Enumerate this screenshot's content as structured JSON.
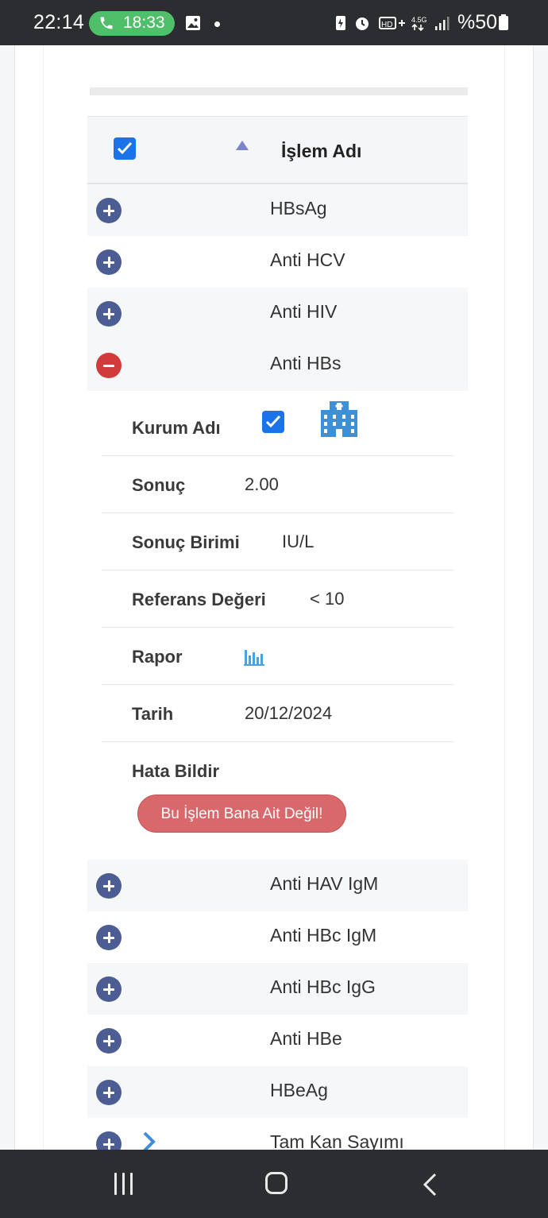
{
  "status_bar": {
    "time": "22:14",
    "call_timer": "18:33",
    "network": "4.5G",
    "battery": "%50"
  },
  "table": {
    "header": {
      "column_title": "İşlem Adı",
      "select_all_checked": true,
      "sort": "ascending"
    },
    "rows_before": [
      {
        "name": "HBsAg",
        "expanded": false
      },
      {
        "name": "Anti HCV",
        "expanded": false
      },
      {
        "name": "Anti HIV",
        "expanded": false
      }
    ],
    "expanded_row": {
      "name": "Anti HBs",
      "expanded": true,
      "details": {
        "kurum_adi_label": "Kurum Adı",
        "kurum_adi_checked": true,
        "sonuc_label": "Sonuç",
        "sonuc_value": "2.00",
        "sonuc_birimi_label": "Sonuç Birimi",
        "sonuc_birimi_value": "IU/L",
        "referans_label": "Referans Değeri",
        "referans_value": "< 10",
        "rapor_label": "Rapor",
        "tarih_label": "Tarih",
        "tarih_value": "20/12/2024",
        "hata_label": "Hata Bildir",
        "hata_button": "Bu İşlem Bana Ait Değil!"
      }
    },
    "rows_after": [
      {
        "name": "Anti HAV IgM",
        "expanded": false
      },
      {
        "name": "Anti HBc IgM",
        "expanded": false
      },
      {
        "name": "Anti HBc IgG",
        "expanded": false
      },
      {
        "name": "Anti HBe",
        "expanded": false
      },
      {
        "name": "HBeAg",
        "expanded": false
      },
      {
        "name": "Tam Kan Sayımı",
        "expanded": false
      }
    ]
  },
  "colors": {
    "status_bar_bg": "#2b2d30",
    "call_pill": "#4fbf69",
    "expand_button": "#4c5d94",
    "collapse_button": "#d23b3b",
    "checkbox": "#1a73e8",
    "error_button": "#d9686b",
    "hospital_icon": "#3d8fd6"
  },
  "icons": {
    "status": [
      "phone-icon",
      "gallery-icon",
      "battery-saver-icon",
      "alarm-icon",
      "volte-icon",
      "data-arrows-icon",
      "signal-icon",
      "battery-icon"
    ],
    "kurum": "hospital-building-icon",
    "rapor": "bar-chart-icon",
    "nav": [
      "recent-apps-icon",
      "home-icon",
      "back-icon"
    ]
  }
}
